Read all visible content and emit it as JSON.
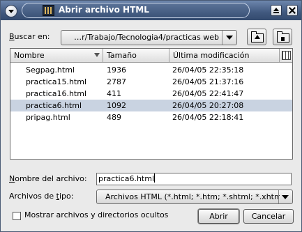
{
  "window": {
    "title": "Abrir archivo HTML"
  },
  "look_in": {
    "label_prefix": "B",
    "label_rest": "uscar en:",
    "path": "…r/Trabajo/Tecnologia4/practicas web"
  },
  "columns": {
    "name": "Nombre",
    "size": "Tamaño",
    "modified": "Última modificación"
  },
  "files": [
    {
      "name": "Segpag.html",
      "size": "1936",
      "modified": "26/04/05 22:35:18",
      "selected": false
    },
    {
      "name": "practica15.html",
      "size": "2787",
      "modified": "26/04/05 21:37:16",
      "selected": false
    },
    {
      "name": "practica16.html",
      "size": "411",
      "modified": "26/04/05 22:41:47",
      "selected": false
    },
    {
      "name": "practica6.html",
      "size": "1092",
      "modified": "26/04/05 20:27:08",
      "selected": true
    },
    {
      "name": "pripag.html",
      "size": "489",
      "modified": "26/04/05 22:18:41",
      "selected": false
    }
  ],
  "filename": {
    "label_prefix": "N",
    "label_rest": "ombre del archivo:",
    "value": "practica6.html"
  },
  "filter": {
    "label_a": "Archivos de ",
    "label_u": "t",
    "label_b": "ipo:",
    "value": "Archivos HTML (*.html; *.htm; *.shtml; *.xhtml)"
  },
  "show_hidden": {
    "label": "Mostrar archivos y directorios ocultos",
    "checked": false
  },
  "buttons": {
    "open": "Abrir",
    "cancel": "Cancelar"
  },
  "icons": {
    "menu": "window-menu-icon",
    "app": "html-file-icon",
    "maximize": "maximize-icon",
    "close": "close-icon",
    "up": "folder-up-icon",
    "home": "folder-home-icon",
    "columns": "column-chooser-icon",
    "sort": "sort-descending-icon"
  }
}
